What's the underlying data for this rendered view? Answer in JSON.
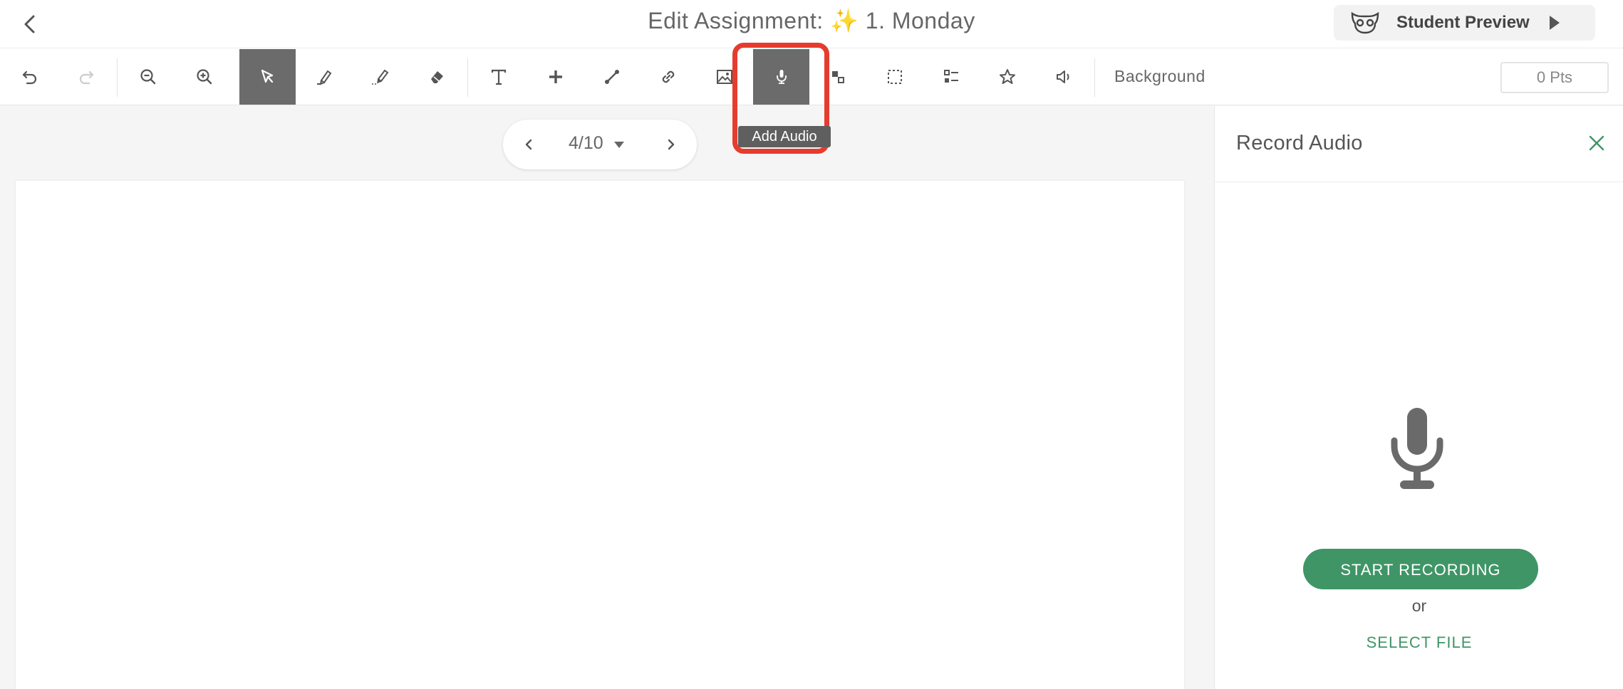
{
  "header": {
    "title": "Edit Assignment: ✨ 1. Monday",
    "preview_label": "Student Preview"
  },
  "toolbar": {
    "tools": [
      {
        "name": "undo",
        "icon": "undo-icon"
      },
      {
        "name": "redo",
        "icon": "redo-icon"
      },
      {
        "name": "zoom-out",
        "icon": "zoom-out-icon"
      },
      {
        "name": "zoom-in",
        "icon": "zoom-in-icon"
      },
      {
        "name": "select",
        "icon": "cursor-icon",
        "active": true
      },
      {
        "name": "pen",
        "icon": "pen-icon"
      },
      {
        "name": "highlighter",
        "icon": "highlighter-icon"
      },
      {
        "name": "eraser",
        "icon": "eraser-icon"
      },
      {
        "name": "text",
        "icon": "text-icon"
      },
      {
        "name": "add",
        "icon": "plus-icon"
      },
      {
        "name": "line",
        "icon": "line-icon"
      },
      {
        "name": "link",
        "icon": "link-icon"
      },
      {
        "name": "image",
        "icon": "image-icon"
      },
      {
        "name": "audio",
        "icon": "microphone-icon",
        "active": true
      },
      {
        "name": "shapes",
        "icon": "shapes-icon"
      },
      {
        "name": "area-select",
        "icon": "dashed-select-icon"
      },
      {
        "name": "question",
        "icon": "checklist-icon"
      },
      {
        "name": "star",
        "icon": "star-icon"
      },
      {
        "name": "speaker",
        "icon": "speaker-icon"
      }
    ],
    "background_label": "Background",
    "points_value": "0 Pts",
    "tooltip": "Add Audio",
    "highlight_color": "#e63c2e"
  },
  "pager": {
    "label": "4/10"
  },
  "panel": {
    "title": "Record Audio",
    "start_button": "START RECORDING",
    "or_text": "or",
    "select_file": "SELECT FILE",
    "accent_color": "#3f9566"
  }
}
